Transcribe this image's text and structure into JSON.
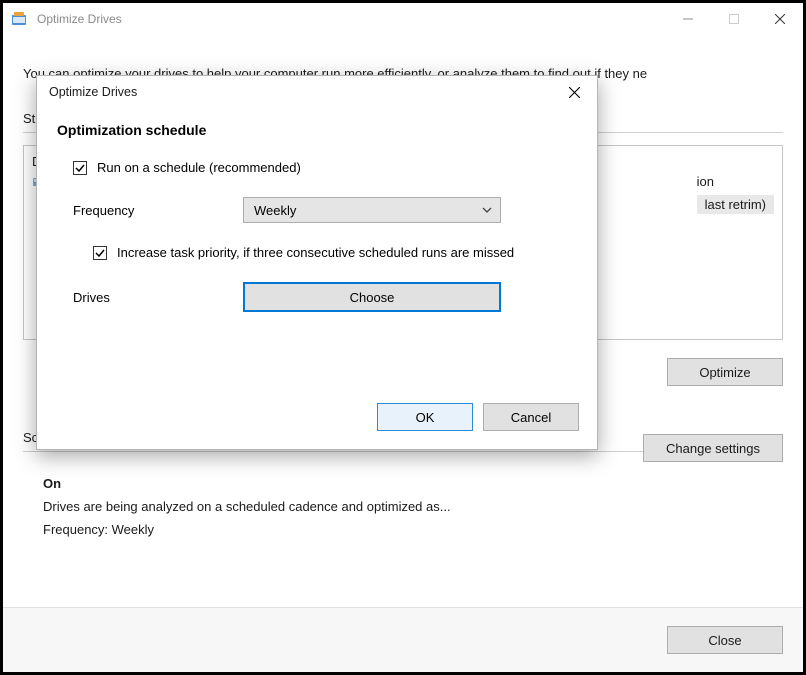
{
  "main": {
    "title": "Optimize Drives",
    "intro": "You can optimize your drives to help your computer run more efficiently, or analyze them to find out if they ne",
    "status_label_prefix": "St",
    "drive_col_header": "D",
    "right_stub_line1": "ion",
    "right_stub_line2": "last retrim)",
    "optimize_btn": "Optimize",
    "sched_label": "Scheduled optimization",
    "sched_on": "On",
    "sched_desc": "Drives are being analyzed on a scheduled cadence and optimized as...",
    "sched_freq": "Frequency: Weekly",
    "change_settings_btn": "Change settings",
    "close_btn": "Close"
  },
  "dialog": {
    "title": "Optimize Drives",
    "heading": "Optimization schedule",
    "run_schedule_label": "Run on a schedule (recommended)",
    "frequency_label": "Frequency",
    "frequency_value": "Weekly",
    "priority_label": "Increase task priority, if three consecutive scheduled runs are missed",
    "drives_label": "Drives",
    "choose_btn": "Choose",
    "ok_btn": "OK",
    "cancel_btn": "Cancel"
  }
}
